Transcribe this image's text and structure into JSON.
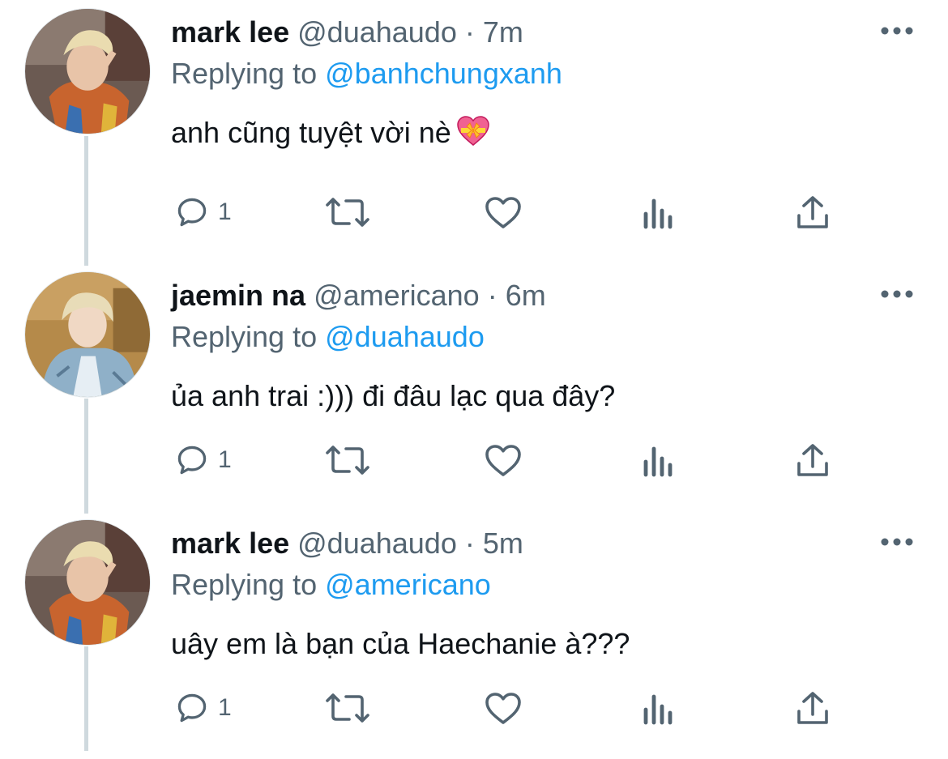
{
  "tweets": [
    {
      "display_name": "mark lee",
      "handle": "@duahaudo",
      "separator": "·",
      "time": "7m",
      "replying_prefix": "Replying to",
      "replying_to": "@banhchungxanh",
      "text": "anh cũng tuyệt vời nè",
      "emoji": "heart-with-ribbon",
      "reply_count": "1"
    },
    {
      "display_name": "jaemin na",
      "handle": "@americano",
      "separator": "·",
      "time": "6m",
      "replying_prefix": "Replying to",
      "replying_to": "@duahaudo",
      "text": "ủa anh trai :))) đi đâu lạc qua đây?",
      "reply_count": "1"
    },
    {
      "display_name": "mark lee",
      "handle": "@duahaudo",
      "separator": "·",
      "time": "5m",
      "replying_prefix": "Replying to",
      "replying_to": "@americano",
      "text": "uây em là bạn của Haechanie à???",
      "reply_count": "1"
    }
  ],
  "icons": {
    "reply": "speech-bubble-icon",
    "retweet": "retweet-icon",
    "like": "heart-icon",
    "views": "bar-chart-icon",
    "share": "share-upload-icon",
    "more": "more-dots-icon"
  },
  "colors": {
    "text": "#0f1419",
    "secondary": "#536471",
    "link": "#1d9bf0",
    "thread_line": "#cfd9de"
  }
}
